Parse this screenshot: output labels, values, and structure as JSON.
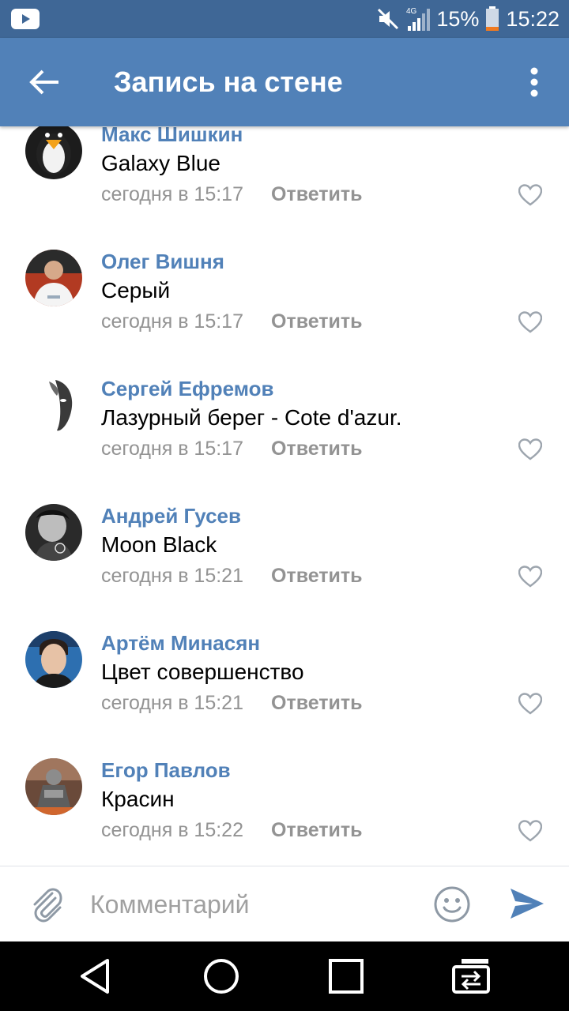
{
  "status_bar": {
    "network": "4G",
    "battery": "15%",
    "time": "15:22",
    "icons": [
      "youtube-icon",
      "mute-icon",
      "signal-icon",
      "battery-icon"
    ]
  },
  "header": {
    "title": "Запись на стене",
    "icons": [
      "back-arrow-icon",
      "more-vert-icon"
    ]
  },
  "comments": [
    {
      "author": "Макс Шишкин",
      "text": "Galaxy Blue",
      "time": "сегодня в 15:17",
      "reply": "Ответить"
    },
    {
      "author": "Олег Вишня",
      "text": "Серый",
      "time": "сегодня в 15:17",
      "reply": "Ответить"
    },
    {
      "author": "Сергей Ефремов",
      "text": "Лазурный берег - Cote d'azur.",
      "time": "сегодня в 15:17",
      "reply": "Ответить"
    },
    {
      "author": "Андрей Гусев",
      "text": "Moon Black",
      "time": "сегодня в 15:21",
      "reply": "Ответить"
    },
    {
      "author": "Артём Минасян",
      "text": "Цвет совершенство",
      "time": "сегодня в 15:21",
      "reply": "Ответить"
    },
    {
      "author": "Егор Павлов",
      "text": "Красин",
      "time": "сегодня в 15:22",
      "reply": "Ответить"
    }
  ],
  "composer": {
    "placeholder": "Комментарий",
    "icons": [
      "paperclip-icon",
      "smile-icon",
      "send-icon"
    ]
  },
  "nav_bar": {
    "icons": [
      "nav-back-icon",
      "nav-home-icon",
      "nav-recents-icon",
      "nav-switch-icon"
    ]
  },
  "colors": {
    "status_bar": "#3f6796",
    "header": "#5181b8",
    "author": "#5181b8",
    "meta": "#939393",
    "send": "#5181b8"
  }
}
